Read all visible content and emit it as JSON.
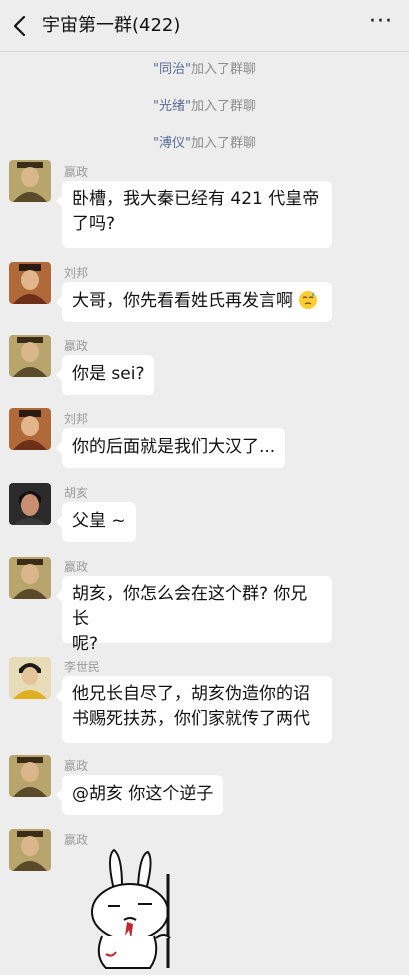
{
  "header": {
    "title": "宇宙第一群(422)",
    "more": "···"
  },
  "system_messages": [
    {
      "name": "\"同治\"",
      "text": "加入了群聊"
    },
    {
      "name": "\"光绪\"",
      "text": "加入了群聊"
    },
    {
      "name": "\"溥仪\"",
      "text": "加入了群聊"
    }
  ],
  "messages": [
    {
      "sender": "嬴政",
      "lines": [
        "卧槽，我大秦已经有 421 代皇帝",
        "了吗?"
      ]
    },
    {
      "sender": "刘邦",
      "lines": [
        "大哥，你先看看姓氏再发言啊"
      ]
    },
    {
      "sender": "嬴政",
      "lines": [
        "你是 sei?"
      ]
    },
    {
      "sender": "刘邦",
      "lines": [
        "你的后面就是我们大汉了..."
      ]
    },
    {
      "sender": "胡亥",
      "lines": [
        "父皇 ~"
      ]
    },
    {
      "sender": "嬴政",
      "lines": [
        "胡亥，你怎么会在这个群? 你兄长",
        "呢?"
      ]
    },
    {
      "sender": "李世民",
      "lines": [
        "他兄长自尽了，胡亥伪造你的诏",
        "书赐死扶苏，你们家就传了两代"
      ]
    },
    {
      "sender": "嬴政",
      "lines": [
        "@胡亥  你这个逆子"
      ]
    },
    {
      "sender": "嬴政",
      "sticker": "rabbit-sticker"
    }
  ],
  "colors": {
    "background": "#ededed",
    "bubble": "#ffffff",
    "system_highlight": "#576b95"
  }
}
